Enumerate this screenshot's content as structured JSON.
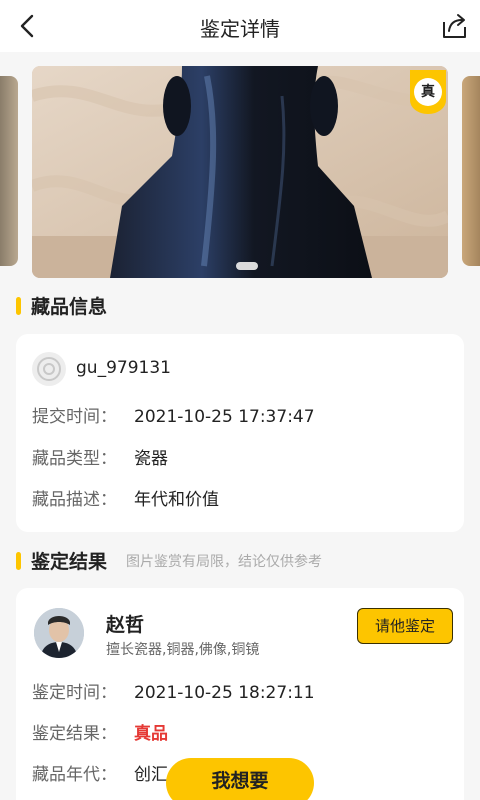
{
  "header": {
    "title": "鉴定详情",
    "back_icon": "chevron-left-icon",
    "share_icon": "share-icon"
  },
  "carousel": {
    "badge": "真",
    "slides_visible": 3,
    "active_index": 1
  },
  "collection_section": {
    "title": "藏品信息",
    "username": "gu_979131",
    "rows": [
      {
        "key": "提交时间：",
        "value": "2021-10-25 17:37:47"
      },
      {
        "key": "藏品类型：",
        "value": "瓷器"
      },
      {
        "key": "藏品描述：",
        "value": "年代和价值"
      }
    ]
  },
  "result_section": {
    "title": "鉴定结果",
    "note": "图片鉴赏有局限，结论仅供参考",
    "expert": {
      "name": "赵哲",
      "skill": "擅长瓷器,铜器,佛像,铜镜",
      "ask_label": "请他鉴定"
    },
    "rows": [
      {
        "key": "鉴定时间：",
        "value": "2021-10-25 18:27:11"
      },
      {
        "key": "鉴定结果：",
        "value": "真品"
      },
      {
        "key": "藏品年代：",
        "value": "创汇"
      }
    ]
  },
  "bottom": {
    "want_label": "我想要"
  },
  "colors": {
    "accent": "#fdc500",
    "result_red": "#e53935",
    "background": "#f6f6f6"
  }
}
